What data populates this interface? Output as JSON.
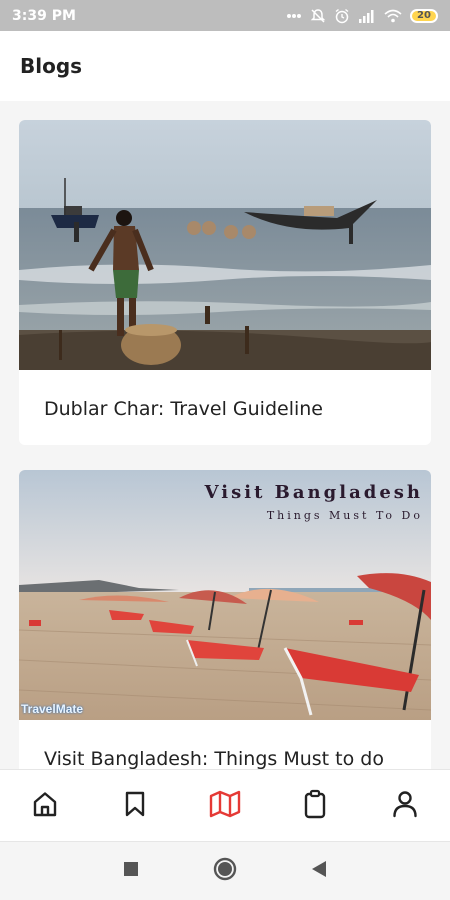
{
  "status_bar": {
    "time": "3:39 PM",
    "icons": [
      "more-dots-icon",
      "notifications-off-icon",
      "alarm-icon",
      "signal-icon",
      "wifi-icon"
    ],
    "battery_level": "20"
  },
  "header": {
    "title": "Blogs"
  },
  "blogs": [
    {
      "title": "Dublar Char: Travel Guideline",
      "image": "fishermen-beach-photo"
    },
    {
      "title": "Visit Bangladesh: Things Must to do",
      "image": "beach-lounge-chairs-photo",
      "overlay_title": "Visit Bangladesh",
      "overlay_subtitle": "Things Must To Do",
      "overlay_logo": "TravelMate"
    }
  ],
  "bottom_nav": {
    "items": [
      "home-icon",
      "bookmark-icon",
      "map-icon",
      "clipboard-icon",
      "profile-icon"
    ],
    "active": "map-icon",
    "active_color": "#e53935",
    "inactive_color": "#222222"
  },
  "system_nav": [
    "recents-square-icon",
    "home-circle-icon",
    "back-triangle-icon"
  ]
}
